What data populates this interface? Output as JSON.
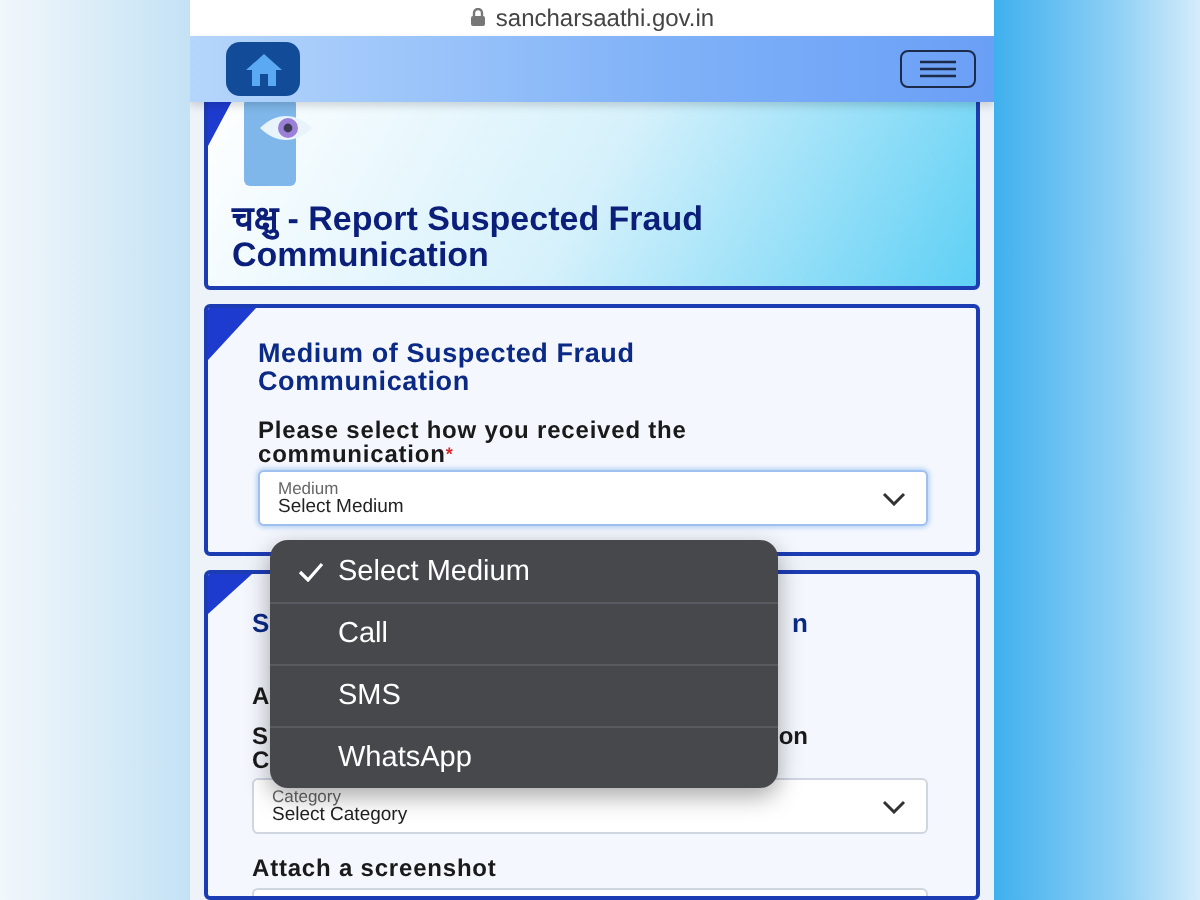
{
  "address_bar": {
    "url": "sancharsaathi.gov.in"
  },
  "hero": {
    "title": "चक्षु - Report Suspected Fraud Communication"
  },
  "medium_card": {
    "heading": "Medium of Suspected Fraud Communication",
    "question": "Please select how you received the communication",
    "required_mark": "*",
    "select": {
      "label": "Medium",
      "value": "Select Medium"
    }
  },
  "category_card": {
    "partial_lines": [
      {
        "kind": "heading",
        "left": "S",
        "right": "n"
      },
      {
        "kind": "text",
        "left": "A"
      },
      {
        "kind": "label",
        "left": "S",
        "right": "on"
      },
      {
        "kind": "label",
        "left": "C"
      }
    ],
    "select": {
      "label": "Category",
      "value": "Select Category"
    },
    "attach_label": "Attach a screenshot"
  },
  "dropdown_menu": {
    "options": [
      {
        "label": "Select Medium",
        "selected": true
      },
      {
        "label": "Call",
        "selected": false
      },
      {
        "label": "SMS",
        "selected": false
      },
      {
        "label": "WhatsApp",
        "selected": false
      }
    ]
  }
}
